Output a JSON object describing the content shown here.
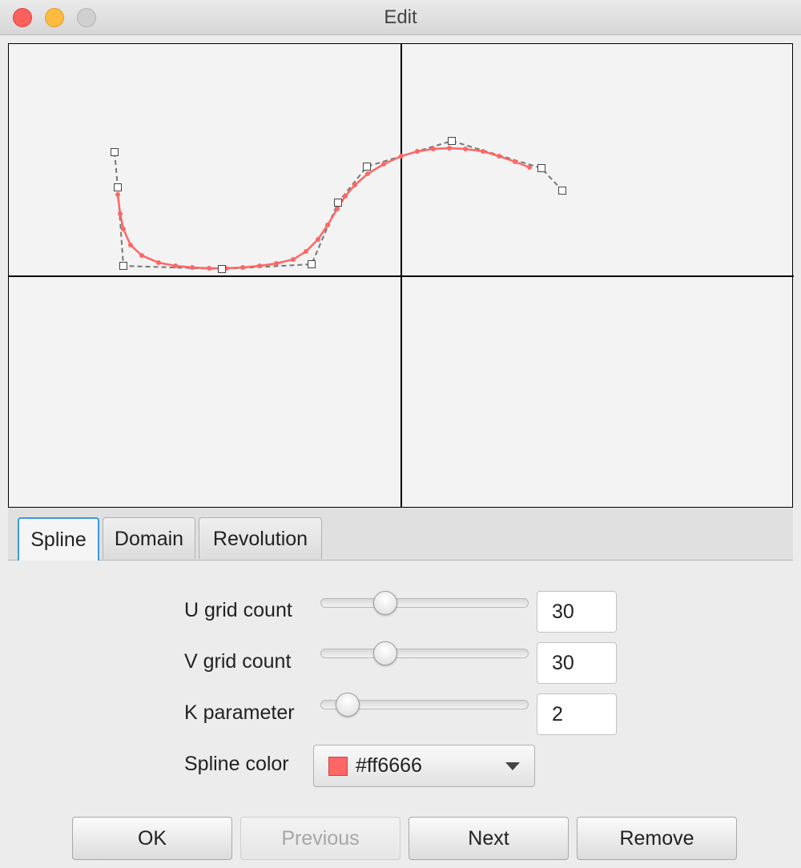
{
  "window": {
    "title": "Edit"
  },
  "tabs": [
    "Spline",
    "Domain",
    "Revolution"
  ],
  "spline_tab": {
    "u_grid": {
      "label": "U grid count",
      "value": "30",
      "level": 0.31
    },
    "v_grid": {
      "label": "V grid count",
      "value": "30",
      "level": 0.31
    },
    "k_param": {
      "label": "K parameter",
      "value": "2",
      "level": 0.13
    },
    "color": {
      "label": "Spline color",
      "value": "#ff6666"
    }
  },
  "buttons": {
    "ok": "OK",
    "previous": "Previous",
    "next": "Next",
    "remove": "Remove"
  },
  "colors": {
    "spline": "#ff6666",
    "control_polygon": "#777777",
    "accent": "#3b9ad9"
  }
}
